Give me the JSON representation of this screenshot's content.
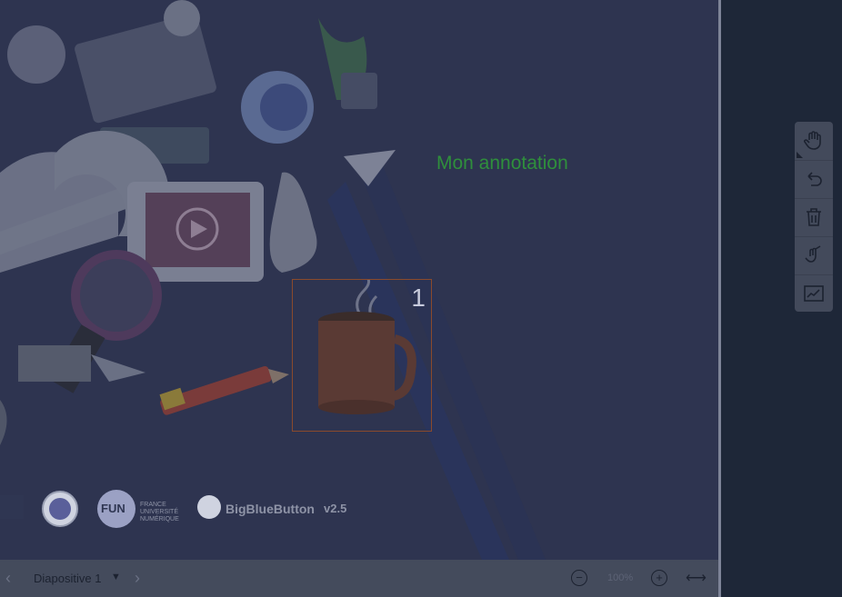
{
  "presentation": {
    "annotation_text": "Mon annotation",
    "coffee_label": "1",
    "logos": {
      "fun_lines": [
        "FRANCE",
        "UNIVERSITÉ",
        "NUMÉRIQUE"
      ],
      "fun_badge": "FUN",
      "bbb_name": "BigBlueButton",
      "bbb_version": "v2.5"
    }
  },
  "bottom_bar": {
    "prev_icon": "chevron-left-icon",
    "slide_label": "Diapositive 1",
    "next_icon": "chevron-right-icon",
    "zoom_value": "100%",
    "zoom_out_icon": "minus-circle-icon",
    "zoom_in_icon": "plus-circle-icon",
    "fit_icon": "fit-width-icon"
  },
  "toolbar": {
    "tools": [
      {
        "name": "pan-tool",
        "icon": "hand-icon"
      },
      {
        "name": "undo-tool",
        "icon": "undo-icon"
      },
      {
        "name": "clear-tool",
        "icon": "trash-icon"
      },
      {
        "name": "multi-user-tool",
        "icon": "multi-user-pen-icon"
      },
      {
        "name": "whiteboard-tool",
        "icon": "chart-line-icon"
      }
    ]
  },
  "colors": {
    "slide_bg": "#2e3450",
    "annotation": "#2f8f3c",
    "sidebar_bg": "#1e2738"
  }
}
